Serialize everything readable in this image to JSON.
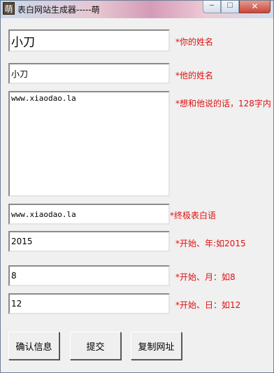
{
  "window": {
    "title": "表白网站生成器-----萌",
    "icon_glyph": "萌",
    "min_glyph": "─",
    "max_glyph": "☐",
    "close_glyph": "✕"
  },
  "form": {
    "your_name": {
      "value": "小刀",
      "label": "*你的姓名"
    },
    "their_name": {
      "value": "小刀",
      "label": "*他的姓名"
    },
    "message": {
      "value": "www.xiaodao.la",
      "label": "*想和他说的话，128字内"
    },
    "final_words": {
      "value": "www.xiaodao.la",
      "label": "*终极表白语"
    },
    "start_year": {
      "value": "2015",
      "label": "*开始、年:如2015"
    },
    "start_month": {
      "value": "8",
      "label": "*开始、月：如8"
    },
    "start_day": {
      "value": "12",
      "label": "*开始、日：如12"
    }
  },
  "buttons": {
    "confirm": "确认信息",
    "submit": "提交",
    "copy_url": "复制网址"
  },
  "colors": {
    "label_red": "#e01010",
    "window_bg": "#f0f0f0"
  }
}
